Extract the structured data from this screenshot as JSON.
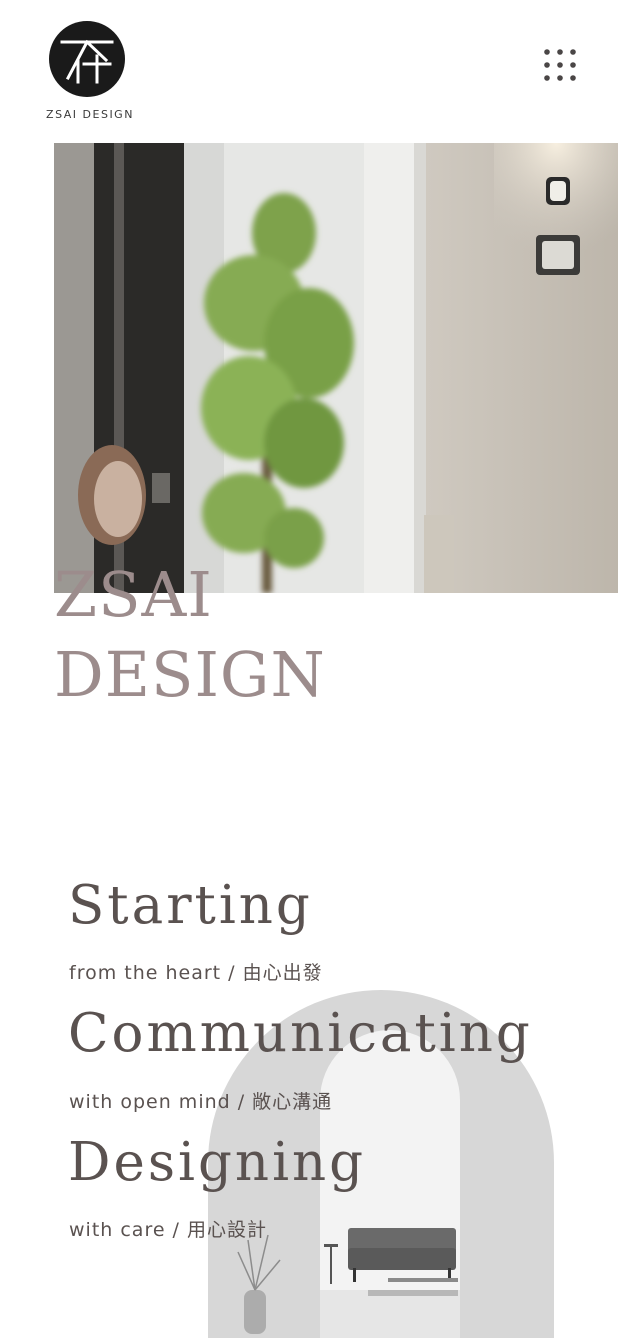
{
  "header": {
    "logo_text": "ZSAI DESIGN",
    "menu_icon": "grid-dots-icon"
  },
  "hero": {
    "brand_line1": "ZSAI",
    "brand_line2": "DESIGN"
  },
  "slogans": [
    {
      "title": "Starting",
      "subtitle": "from the heart / 由心出發"
    },
    {
      "title": "Communicating",
      "subtitle": "with open mind / 敞心溝通"
    },
    {
      "title": "Designing",
      "subtitle": "with care / 用心設計"
    }
  ],
  "colors": {
    "brand": "#9c8c8c",
    "text": "#5a5250",
    "logo": "#1a1a1a"
  }
}
